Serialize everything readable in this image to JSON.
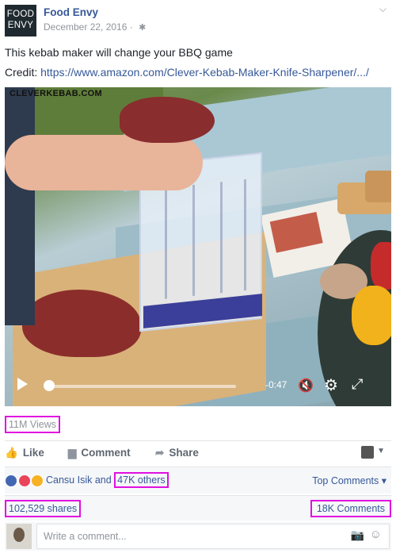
{
  "post": {
    "page_name": "Food Envy",
    "logo_line1": "FOOD",
    "logo_line2": "ENVY",
    "date": "December 22, 2016 ·",
    "text": "This kebab maker will change your BBQ game",
    "credit_label": "Credit: ",
    "credit_url": "https://www.amazon.com/Clever-Kebab-Maker-Knife-Sharpener/.../"
  },
  "video": {
    "watermark": "CLEVERKEBAB.COM",
    "time_remaining": "-0:47",
    "progress": 0.0
  },
  "stats": {
    "views": "11M Views",
    "reactions_prefix": "Cansu Isik and ",
    "reactions_others": "47K others",
    "top_comments": "Top Comments ▾",
    "shares": "102,529 shares",
    "comments": "18K Comments"
  },
  "actions": {
    "like": "Like",
    "comment": "Comment",
    "share": "Share"
  },
  "comment_box": {
    "placeholder": "Write a comment..."
  },
  "colors": {
    "link": "#365899",
    "highlight": "#e010e0",
    "muted": "#90949c"
  }
}
